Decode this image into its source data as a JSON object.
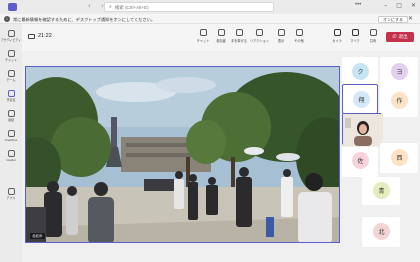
{
  "titlebar": {
    "search_placeholder": "検索 (Ctrl+Alt+E)",
    "more": "•••"
  },
  "notification": {
    "message": "常に最新情報を確認するために、デスクトップ通知をオンにしてください。",
    "button": "オンにする",
    "close": "✕"
  },
  "rail": [
    {
      "label": "アクティビティ"
    },
    {
      "label": "チャット"
    },
    {
      "label": "チーム"
    },
    {
      "label": "予定表"
    },
    {
      "label": "通話"
    },
    {
      "label": "OneDrive"
    },
    {
      "label": "Copilot"
    },
    {
      "label": "アプリ"
    }
  ],
  "meeting": {
    "timer": "21:22",
    "toolbar": [
      {
        "label": "チャット"
      },
      {
        "label": "参加者"
      },
      {
        "label": "手を挙げる"
      },
      {
        "label": "リアクション"
      },
      {
        "label": "表示"
      },
      {
        "label": "その他"
      },
      {
        "label": "カメラ"
      },
      {
        "label": "マイク"
      },
      {
        "label": "共有"
      }
    ],
    "participants_count": "24",
    "leave_label": "退出"
  },
  "main_video": {
    "speaker_label": "北北歩"
  },
  "gallery": [
    {
      "initial": "ク",
      "color": "#c7e4f3"
    },
    {
      "initial": "ヨ",
      "color": "#e3d0ef"
    },
    {
      "initial": "翔",
      "color": "#d4e8f7"
    },
    {
      "initial": "作",
      "color": "#fbe3c8"
    },
    {
      "initial": "佐",
      "color": "#f7d3dc"
    },
    {
      "initial": "西",
      "color": "#fde2c6"
    },
    {
      "initial": "青",
      "color": "#e6ecbe"
    },
    {
      "initial": "北",
      "color": "#f5d4d4"
    }
  ],
  "colors": {
    "accent": "#5b5fc7",
    "leave": "#c4314b"
  }
}
